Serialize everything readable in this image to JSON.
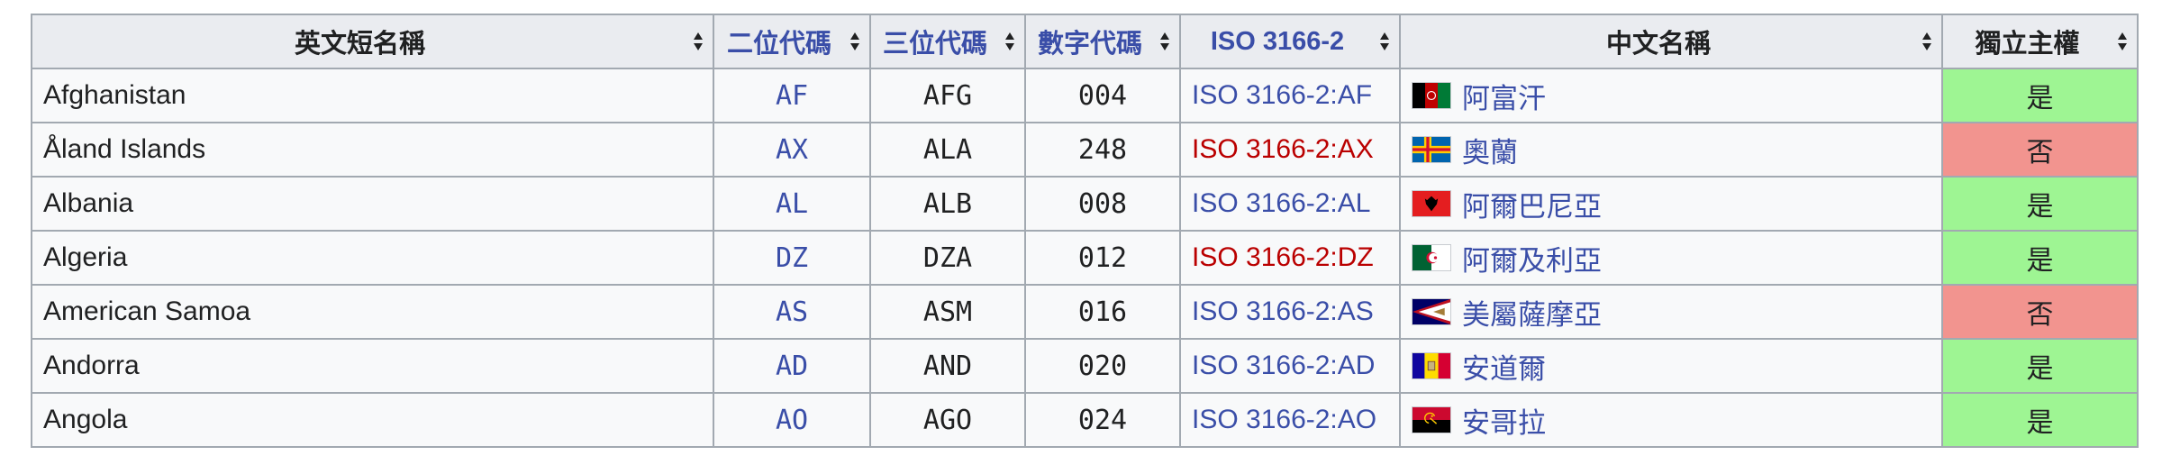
{
  "table": {
    "headers": [
      {
        "label": "英文短名稱",
        "is_link": false
      },
      {
        "label": "二位代碼",
        "is_link": true
      },
      {
        "label": "三位代碼",
        "is_link": true
      },
      {
        "label": "數字代碼",
        "is_link": true
      },
      {
        "label": "ISO 3166-2",
        "is_link": true
      },
      {
        "label": "中文名稱",
        "is_link": false
      },
      {
        "label": "獨立主權",
        "is_link": false
      }
    ],
    "rows": [
      {
        "name": "Afghanistan",
        "alpha2": "AF",
        "alpha3": "AFG",
        "numeric": "004",
        "iso": "ISO 3166-2:AF",
        "iso_redlink": false,
        "flag": "afghanistan-flag",
        "zh": "阿富汗",
        "sovereign": "是",
        "sovereign_status": "yes"
      },
      {
        "name": "Åland Islands",
        "alpha2": "AX",
        "alpha3": "ALA",
        "numeric": "248",
        "iso": "ISO 3166-2:AX",
        "iso_redlink": true,
        "flag": "aland-flag",
        "zh": "奧蘭",
        "sovereign": "否",
        "sovereign_status": "no"
      },
      {
        "name": "Albania",
        "alpha2": "AL",
        "alpha3": "ALB",
        "numeric": "008",
        "iso": "ISO 3166-2:AL",
        "iso_redlink": false,
        "flag": "albania-flag",
        "zh": "阿爾巴尼亞",
        "sovereign": "是",
        "sovereign_status": "yes"
      },
      {
        "name": "Algeria",
        "alpha2": "DZ",
        "alpha3": "DZA",
        "numeric": "012",
        "iso": "ISO 3166-2:DZ",
        "iso_redlink": true,
        "flag": "algeria-flag",
        "zh": "阿爾及利亞",
        "sovereign": "是",
        "sovereign_status": "yes"
      },
      {
        "name": "American Samoa",
        "alpha2": "AS",
        "alpha3": "ASM",
        "numeric": "016",
        "iso": "ISO 3166-2:AS",
        "iso_redlink": false,
        "flag": "american-samoa-flag",
        "zh": "美屬薩摩亞",
        "sovereign": "否",
        "sovereign_status": "no"
      },
      {
        "name": "Andorra",
        "alpha2": "AD",
        "alpha3": "AND",
        "numeric": "020",
        "iso": "ISO 3166-2:AD",
        "iso_redlink": false,
        "flag": "andorra-flag",
        "zh": "安道爾",
        "sovereign": "是",
        "sovereign_status": "yes"
      },
      {
        "name": "Angola",
        "alpha2": "AO",
        "alpha3": "AGO",
        "numeric": "024",
        "iso": "ISO 3166-2:AO",
        "iso_redlink": false,
        "flag": "angola-flag",
        "zh": "安哥拉",
        "sovereign": "是",
        "sovereign_status": "yes"
      }
    ]
  },
  "colors": {
    "link": "#3a4ea8",
    "redlink": "#ba0000",
    "sovereign_yes": "#9ef593",
    "sovereign_no": "#f2948f",
    "header_bg": "#eaecf0",
    "border": "#a2a9b1"
  },
  "icons": {
    "sort": "sort-arrows-icon"
  }
}
